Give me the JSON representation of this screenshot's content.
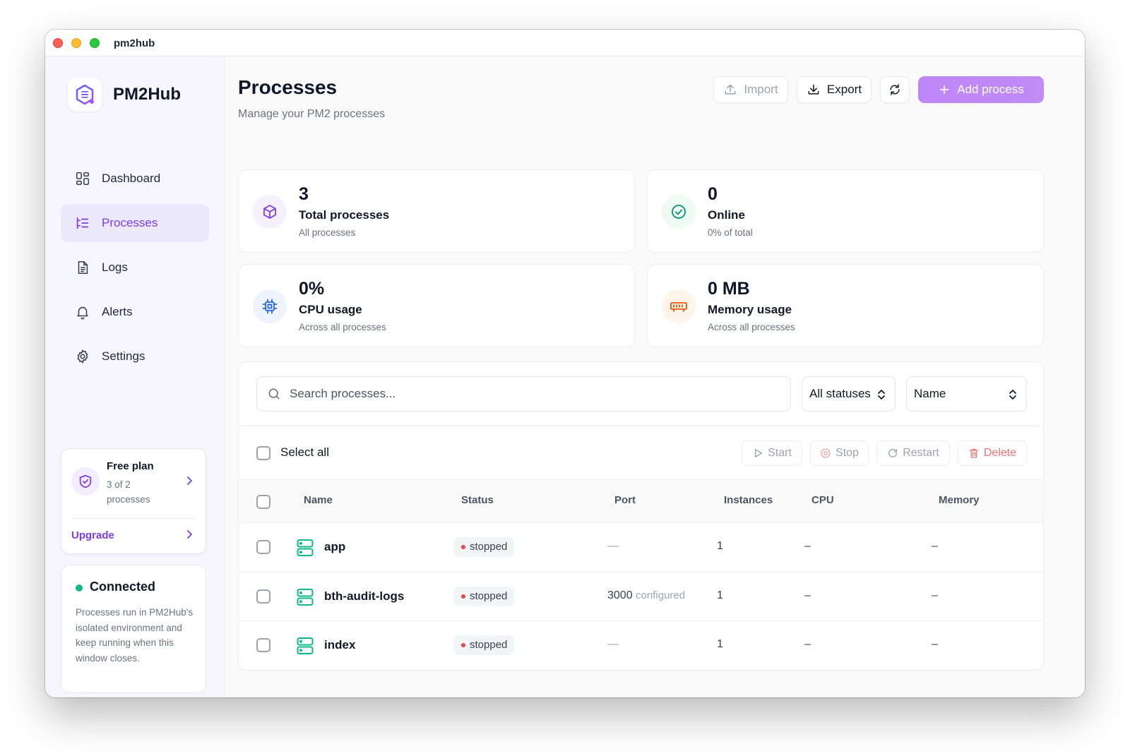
{
  "window": {
    "title": "pm2hub"
  },
  "brand": {
    "name": "PM2Hub"
  },
  "nav": [
    {
      "label": "Dashboard",
      "icon": "dashboard-icon"
    },
    {
      "label": "Processes",
      "icon": "list-icon",
      "active": true
    },
    {
      "label": "Logs",
      "icon": "file-icon"
    },
    {
      "label": "Alerts",
      "icon": "bell-icon"
    },
    {
      "label": "Settings",
      "icon": "gear-icon"
    }
  ],
  "plan": {
    "title": "Free plan",
    "usage": "3 of 2 processes",
    "upgrade": "Upgrade"
  },
  "connection": {
    "status": "Connected",
    "description": "Processes run in PM2Hub's isolated environment and keep running when this window closes."
  },
  "header": {
    "title": "Processes",
    "subtitle": "Manage your PM2 processes"
  },
  "toolbar": {
    "import": "Import",
    "export": "Export",
    "add": "Add process"
  },
  "stats": [
    {
      "value": "3",
      "label": "Total processes",
      "sub": "All processes",
      "icon": "box-icon"
    },
    {
      "value": "0",
      "label": "Online",
      "sub": "0% of total",
      "icon": "check-circle-icon"
    },
    {
      "value": "0%",
      "label": "CPU usage",
      "sub": "Across all processes",
      "icon": "cpu-icon"
    },
    {
      "value": "0 MB",
      "label": "Memory usage",
      "sub": "Across all processes",
      "icon": "memory-icon"
    }
  ],
  "filters": {
    "search_placeholder": "Search processes...",
    "status": "All statuses",
    "sort": "Name"
  },
  "bulk": {
    "select_all": "Select all",
    "start": "Start",
    "stop": "Stop",
    "restart": "Restart",
    "delete": "Delete"
  },
  "table": {
    "columns": [
      "Name",
      "Status",
      "Port",
      "Instances",
      "CPU",
      "Memory"
    ],
    "rows": [
      {
        "name": "app",
        "status": "stopped",
        "port": "—",
        "port_note": "",
        "instances": "1",
        "cpu": "–",
        "memory": "–"
      },
      {
        "name": "bth-audit-logs",
        "status": "stopped",
        "port": "3000",
        "port_note": "configured",
        "instances": "1",
        "cpu": "–",
        "memory": "–"
      },
      {
        "name": "index",
        "status": "stopped",
        "port": "—",
        "port_note": "",
        "instances": "1",
        "cpu": "–",
        "memory": "–"
      }
    ]
  },
  "colors": {
    "accent": "#7c3aed",
    "add_button": "#c084fc",
    "online": "#10b981",
    "stopped": "#ef4444"
  }
}
